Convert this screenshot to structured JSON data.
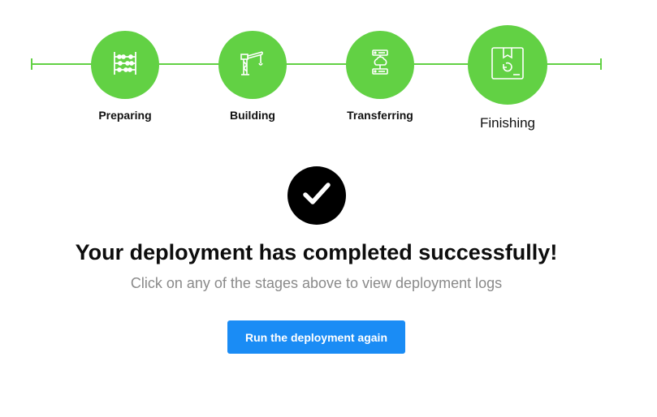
{
  "stages": [
    {
      "label": "Preparing",
      "icon": "abacus-icon"
    },
    {
      "label": "Building",
      "icon": "crane-icon"
    },
    {
      "label": "Transferring",
      "icon": "cloud-server-icon"
    },
    {
      "label": "Finishing",
      "icon": "package-box-icon"
    }
  ],
  "status": {
    "icon": "checkmark-icon",
    "headline": "Your deployment has completed successfully!",
    "subline": "Click on any of the stages above to view deployment logs"
  },
  "actions": {
    "run_again_label": "Run the deployment again"
  },
  "colors": {
    "stage_green": "#62d144",
    "button_blue": "#1a8cf5",
    "check_black": "#000000",
    "subtext_gray": "#8a8a8a"
  }
}
